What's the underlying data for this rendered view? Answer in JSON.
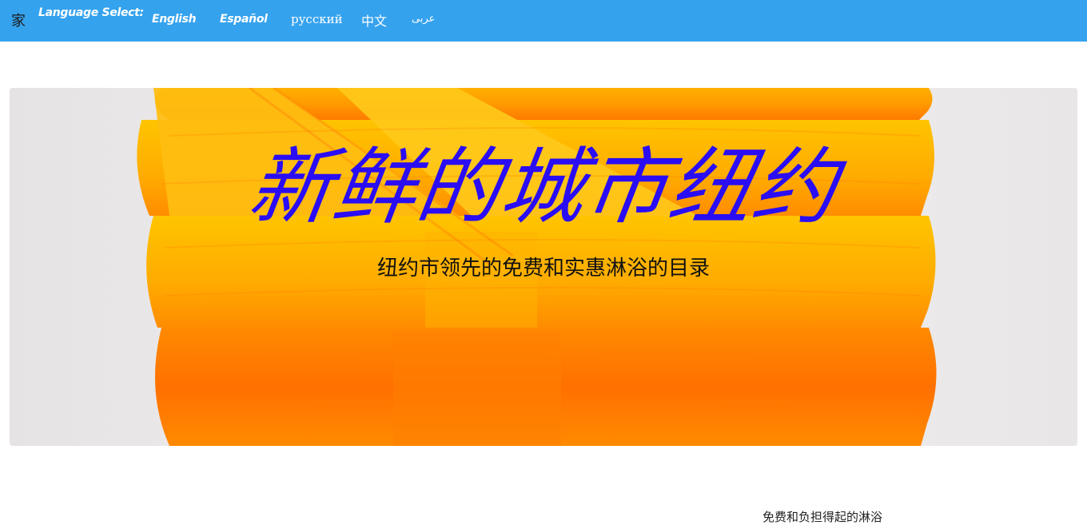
{
  "nav": {
    "home_label": "家",
    "language_select_label": "Language Select:",
    "languages": [
      {
        "label": "English"
      },
      {
        "label": "Español"
      },
      {
        "label": "русский"
      },
      {
        "label": "中文"
      },
      {
        "label": "عربى"
      }
    ],
    "bar_color": "#35a2ee"
  },
  "hero": {
    "title": "新鲜的城市纽约",
    "subtitle": "纽约市领先的免费和实惠淋浴的目录",
    "title_color": "#2a0df2",
    "image": "stacked-orange-towels"
  },
  "below": {
    "partial_text": "免费和负担得起的淋浴"
  }
}
